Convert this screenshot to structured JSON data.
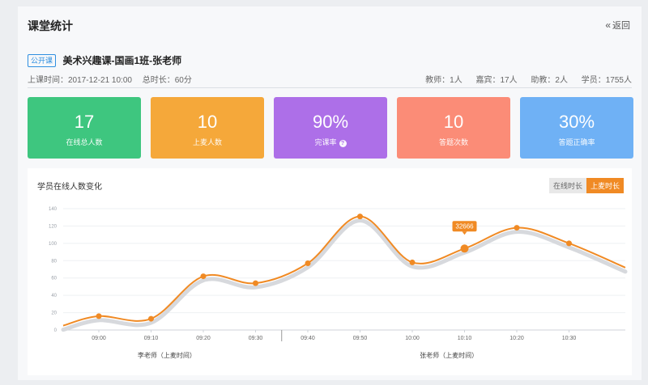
{
  "header": {
    "title": "课堂统计",
    "back_label": "返回"
  },
  "course": {
    "tag": "公开课",
    "name": "美术兴趣课-国画1班-张老师",
    "time_label": "上课时间：2017-12-21  10:00",
    "duration_label": "总时长：60分",
    "teachers": "教师：1人",
    "guests": "嘉宾：17人",
    "assistants": "助教：2人",
    "students": "学员：1755人"
  },
  "cards": [
    {
      "value": "17",
      "label": "在线总人数",
      "color": "#3ec67f"
    },
    {
      "value": "10",
      "label": "上麦人数",
      "color": "#f5a83a"
    },
    {
      "value": "90%",
      "label": "完课率",
      "color": "#ad6fe8"
    },
    {
      "value": "10",
      "label": "答题次数",
      "color": "#fb8c77"
    },
    {
      "value": "30%",
      "label": "答题正确率",
      "color": "#6fb1f5"
    }
  ],
  "chart_panel": {
    "title": "学员在线人数变化",
    "toggle_off": "在线时长",
    "toggle_on": "上麦时长",
    "tooltip": "32666"
  },
  "chart_data": {
    "type": "line",
    "x": [
      "09:00",
      "09:10",
      "09:20",
      "09:30",
      "09:40",
      "09:50",
      "10:00",
      "10:10",
      "10:20",
      "10:30"
    ],
    "values": [
      16,
      13,
      62,
      54,
      77,
      131,
      78,
      94,
      118,
      100
    ],
    "ylim": [
      0,
      140
    ],
    "yticks": [
      0,
      20,
      40,
      60,
      80,
      100,
      120,
      140
    ],
    "highlight_index": 7,
    "group_labels": [
      "李老师（上麦时间）",
      "张老师（上麦时间）"
    ],
    "line_color": "#f08a24"
  }
}
